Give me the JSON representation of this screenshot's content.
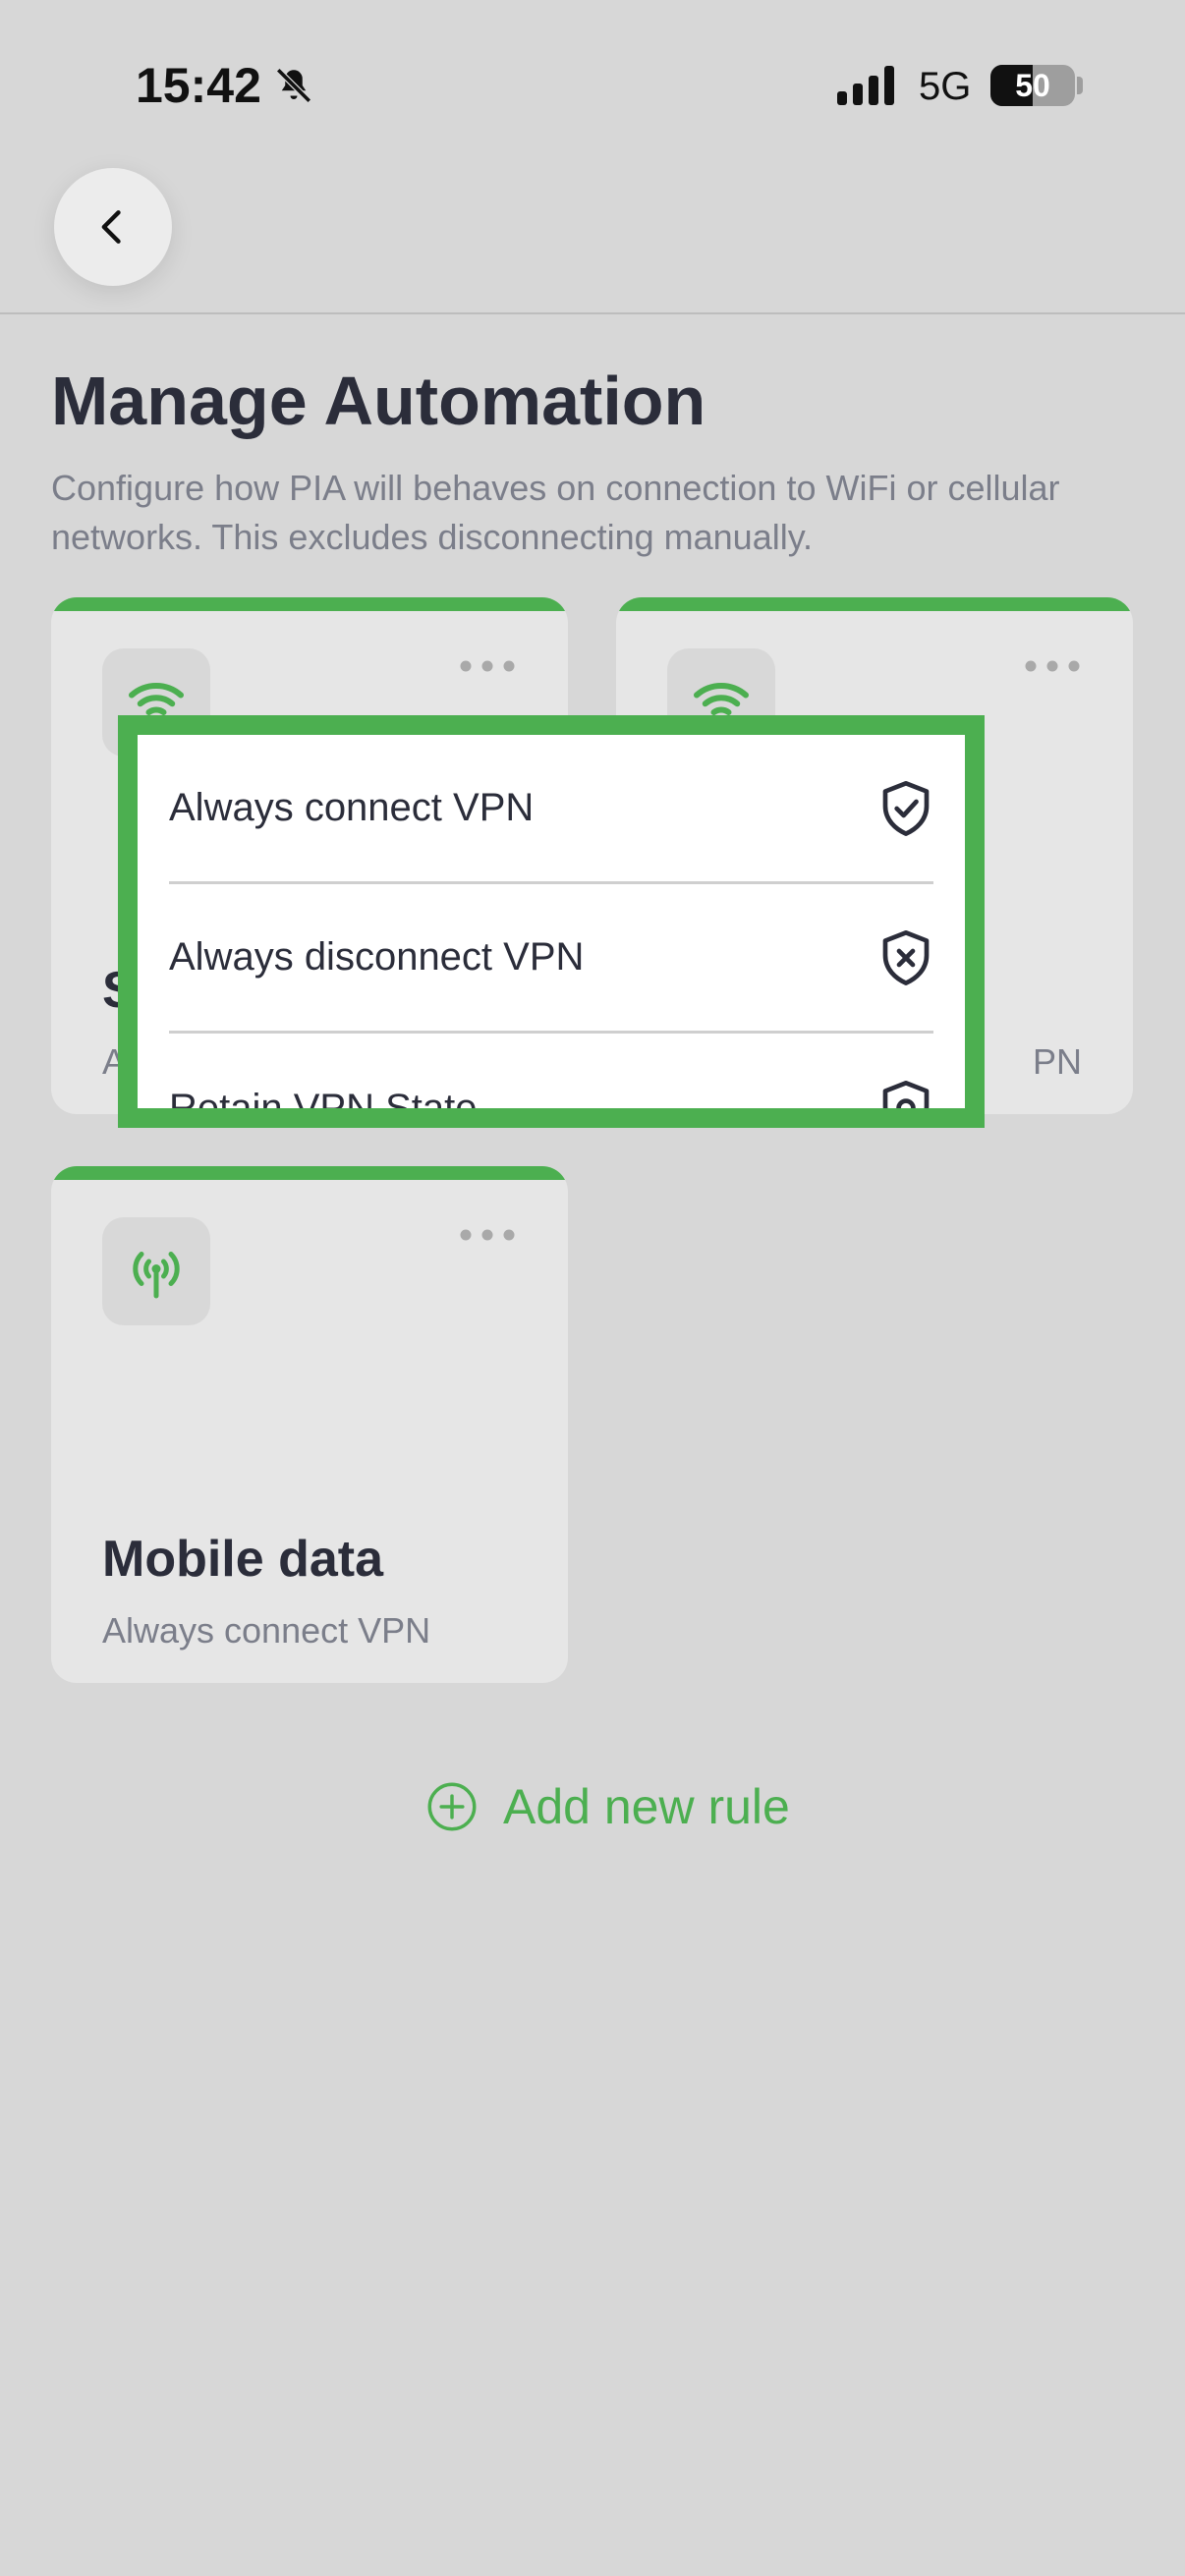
{
  "status_bar": {
    "time": "15:42",
    "network": "5G",
    "battery": "50",
    "battery_level_percent": 50
  },
  "header": {
    "title": "Manage Automation",
    "description": "Configure how PIA will behaves on connection to WiFi or cellular networks. This excludes disconnecting manually."
  },
  "cards": [
    {
      "title": "S",
      "subtitle": "A",
      "icon": "wifi-lock-icon"
    },
    {
      "title": "",
      "subtitle": "PN",
      "icon": "wifi-icon"
    },
    {
      "title": "Mobile data",
      "subtitle": "Always connect VPN",
      "icon": "antenna-icon"
    }
  ],
  "add_rule": {
    "label": "Add new rule"
  },
  "menu": {
    "items": [
      {
        "label": "Always connect VPN",
        "icon": "shield-check-icon"
      },
      {
        "label": "Always disconnect VPN",
        "icon": "shield-x-icon"
      },
      {
        "label": "Retain VPN State",
        "icon": "shield-gear-icon"
      }
    ]
  },
  "colors": {
    "accent": "#4caf50",
    "background": "#d7d7d7",
    "card": "#e6e6e6",
    "text": "#2b2d3a",
    "muted": "#7b7e8a"
  }
}
